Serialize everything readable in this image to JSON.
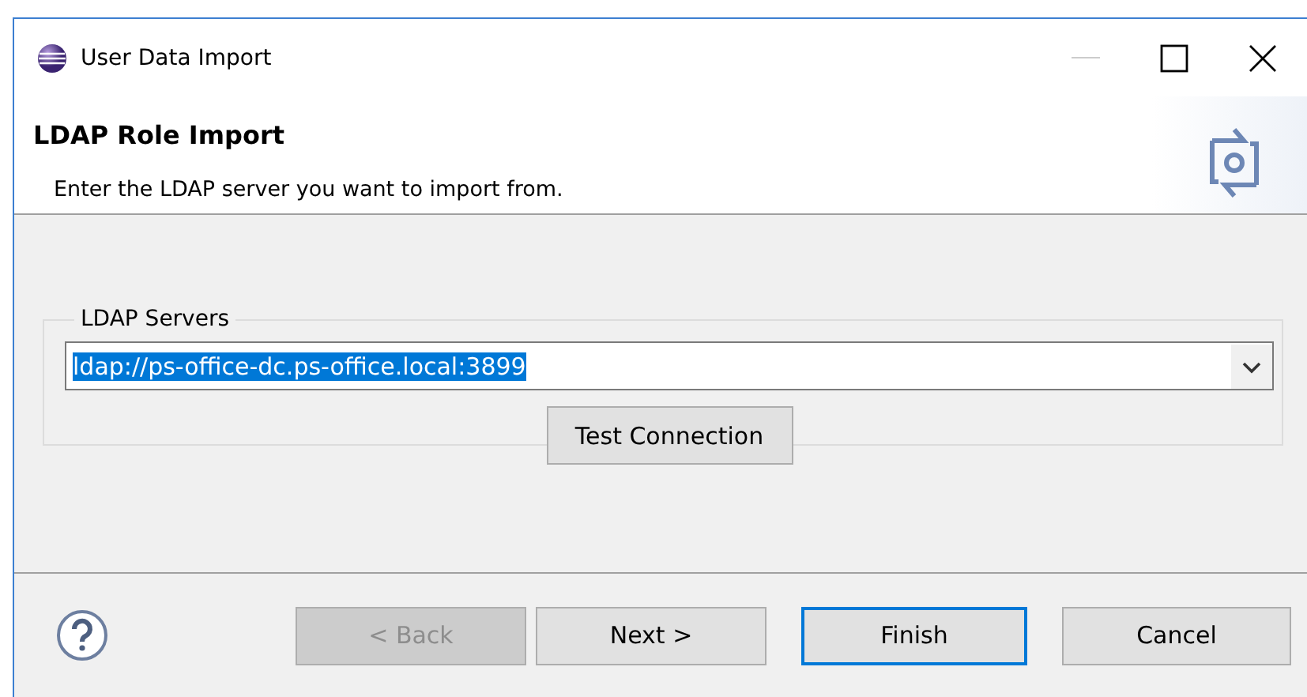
{
  "window": {
    "title": "User Data Import"
  },
  "header": {
    "title": "LDAP Role Import",
    "description": "Enter the LDAP server you want to import from."
  },
  "group": {
    "legend": "LDAP Servers",
    "combo": {
      "value": "ldap://ps-office-dc.ps-office.local:3899",
      "selected": true
    },
    "test_button": "Test Connection"
  },
  "buttons": [
    {
      "label": "< Back",
      "disabled": true,
      "default": false
    },
    {
      "label": "Next >",
      "disabled": false,
      "default": false
    },
    {
      "label": "Finish",
      "disabled": false,
      "default": true
    },
    {
      "label": "Cancel",
      "disabled": false,
      "default": false
    }
  ]
}
